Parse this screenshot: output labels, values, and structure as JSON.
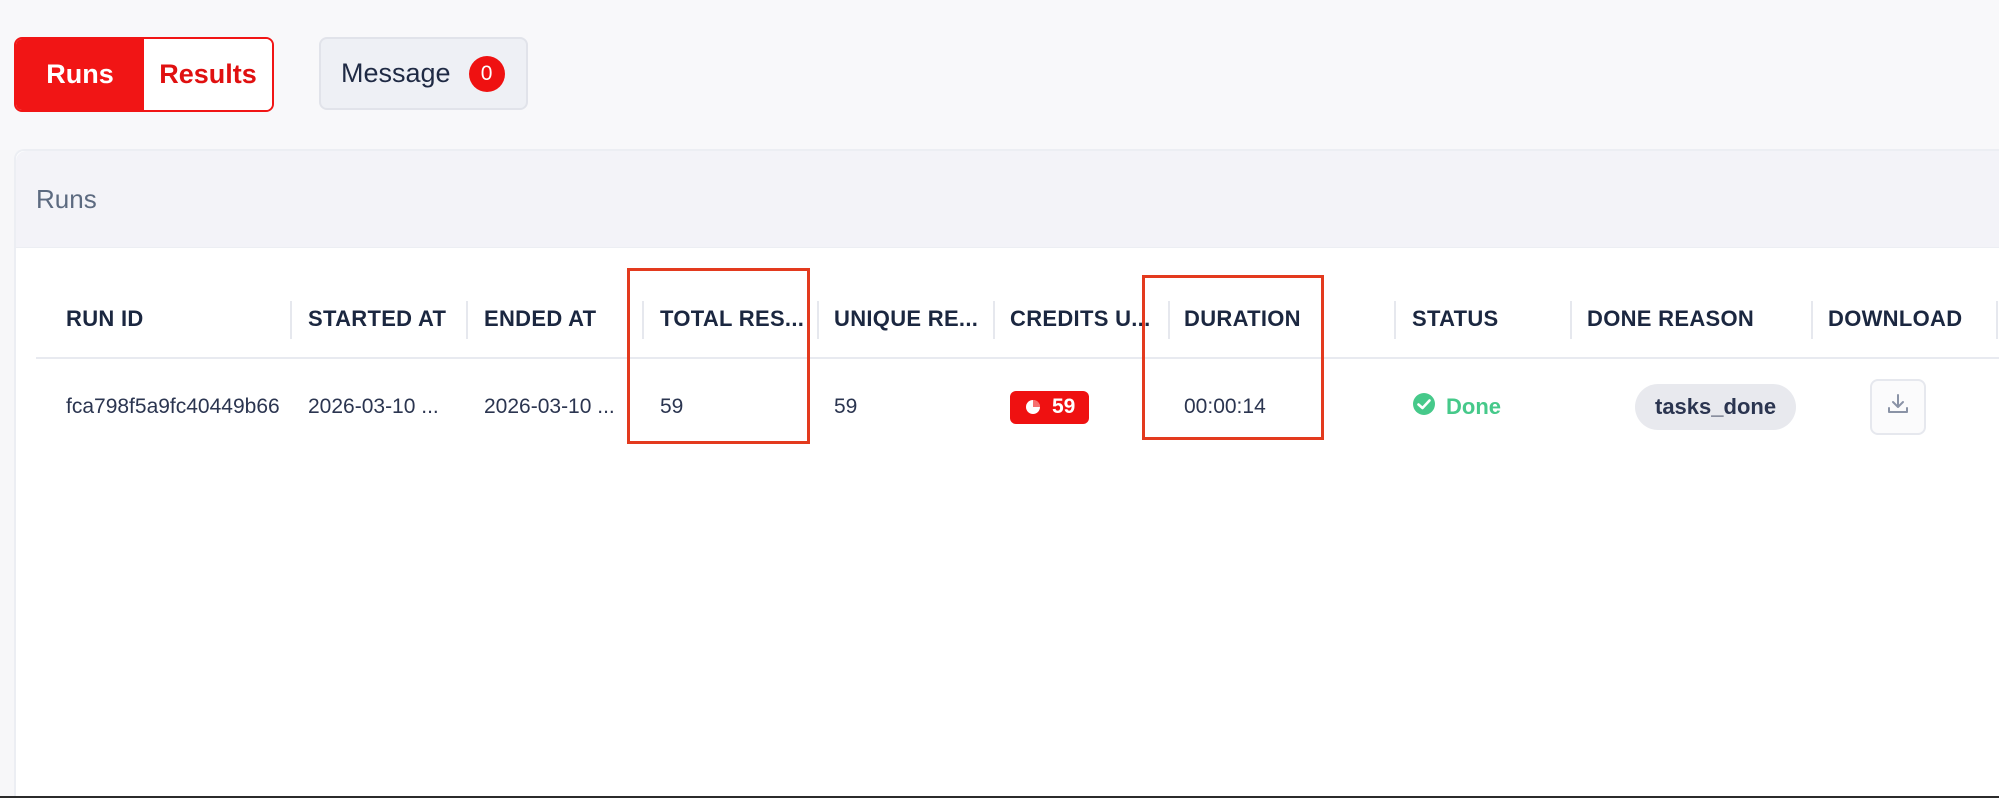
{
  "tabs": {
    "runs_label": "Runs",
    "results_label": "Results"
  },
  "message": {
    "label": "Message",
    "count": "0"
  },
  "card": {
    "title": "Runs"
  },
  "table": {
    "columns": [
      "RUN ID",
      "STARTED AT",
      "ENDED AT",
      "TOTAL RES...",
      "UNIQUE RE...",
      "CREDITS U...",
      "DURATION",
      "STATUS",
      "DONE REASON",
      "DOWNLOAD"
    ],
    "rows": [
      {
        "run_id": "fca798f5a9fc40449b66",
        "started_at": "2026-03-10 ...",
        "ended_at": "2026-03-10 ...",
        "total_results": "59",
        "unique_results": "59",
        "credits_used": "59",
        "duration": "00:00:14",
        "status": "Done",
        "done_reason": "tasks_done"
      }
    ]
  },
  "colors": {
    "brand_red": "#f11515",
    "status_green": "#46c98a",
    "highlight": "#e33a1e"
  },
  "icons": {
    "credits": "coin-icon",
    "status": "check-circle-icon",
    "download": "download-icon"
  }
}
